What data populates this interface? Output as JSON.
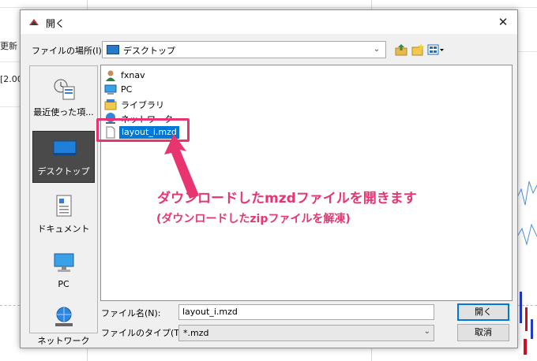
{
  "background": {
    "left_text_1": "更新",
    "left_text_2": "[2.00"
  },
  "dialog": {
    "title": "開く",
    "close_glyph": "✕",
    "location_label": "ファイルの場所(I):",
    "location_value": "デスクトップ",
    "places": [
      {
        "label": "最近使った項...",
        "icon": "recent-icon"
      },
      {
        "label": "デスクトップ",
        "icon": "desktop-icon"
      },
      {
        "label": "ドキュメント",
        "icon": "documents-icon"
      },
      {
        "label": "PC",
        "icon": "pc-icon"
      },
      {
        "label": "ネットワーク",
        "icon": "network-icon"
      }
    ],
    "files": [
      {
        "name": "fxnav",
        "icon": "user-folder-icon"
      },
      {
        "name": "PC",
        "icon": "pc-icon"
      },
      {
        "name": "ライブラリ",
        "icon": "library-icon"
      },
      {
        "name": "ネットワーク",
        "icon": "network-icon"
      },
      {
        "name": "layout_i.mzd",
        "icon": "file-icon"
      }
    ],
    "filename_label": "ファイル名(N):",
    "filename_value": "layout_i.mzd",
    "filetype_label": "ファイルのタイプ(T):",
    "filetype_value": "*.mzd",
    "open_button": "開く",
    "cancel_button": "取消"
  },
  "annotation": {
    "main": "ダウンロードしたmzdファイルを開きます",
    "sub": "(ダウンロードしたzipファイルを解凍)",
    "color": "#e8356f"
  }
}
